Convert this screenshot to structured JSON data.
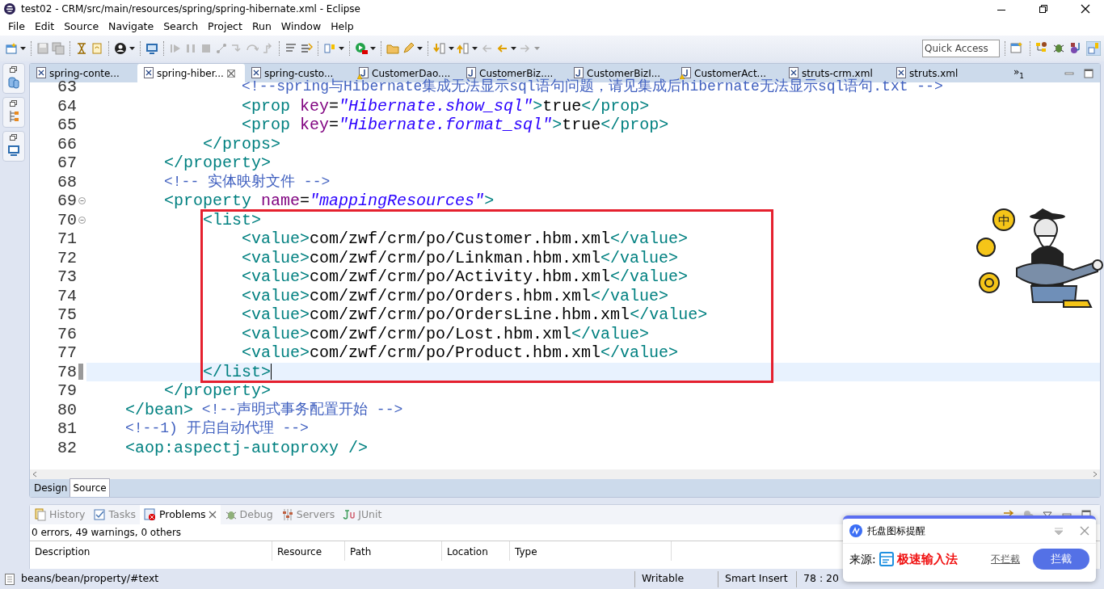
{
  "window": {
    "title": "test02 - CRM/src/main/resources/spring/spring-hibernate.xml - Eclipse"
  },
  "menu": [
    "File",
    "Edit",
    "Source",
    "Navigate",
    "Search",
    "Project",
    "Run",
    "Window",
    "Help"
  ],
  "quick_access": {
    "placeholder": "Quick Access"
  },
  "editor_tabs": [
    {
      "label": "spring-conte...",
      "kind": "xml",
      "selected": false,
      "warning": false
    },
    {
      "label": "spring-hiber...",
      "kind": "xml",
      "selected": true,
      "warning": false
    },
    {
      "label": "spring-custo...",
      "kind": "xml",
      "selected": false,
      "warning": false
    },
    {
      "label": "CustomerDao....",
      "kind": "java",
      "selected": false,
      "warning": true
    },
    {
      "label": "CustomerBiz....",
      "kind": "java",
      "selected": false,
      "warning": false
    },
    {
      "label": "CustomerBizI...",
      "kind": "java",
      "selected": false,
      "warning": false
    },
    {
      "label": "CustomerAct...",
      "kind": "java",
      "selected": false,
      "warning": true
    },
    {
      "label": "struts-crm.xml",
      "kind": "xml",
      "selected": false,
      "warning": false
    },
    {
      "label": "struts.xml",
      "kind": "xml",
      "selected": false,
      "warning": false
    }
  ],
  "tab_overflow": {
    "symbol": "»",
    "count": "1"
  },
  "editor": {
    "sections": [
      {
        "highlighted": false,
        "lines": [
          {
            "number": "63",
            "fold": false,
            "current": false,
            "segments": [
              {
                "kind": "comment",
                "text": "                <!--spring与Hibernate集成无法显示sql语句问题，请见集成后hibernate无法显示sql语句.txt -->"
              }
            ]
          },
          {
            "number": "64",
            "fold": false,
            "current": false,
            "segments": [
              {
                "kind": "tag",
                "text": "                <prop "
              },
              {
                "kind": "attr",
                "text": "key"
              },
              {
                "kind": "text",
                "text": "="
              },
              {
                "kind": "value",
                "text": "\"Hibernate.show_sql\""
              },
              {
                "kind": "tag",
                "text": ">"
              },
              {
                "kind": "text",
                "text": "true"
              },
              {
                "kind": "tag",
                "text": "</prop>"
              }
            ]
          },
          {
            "number": "65",
            "fold": false,
            "current": false,
            "segments": [
              {
                "kind": "tag",
                "text": "                <prop "
              },
              {
                "kind": "attr",
                "text": "key"
              },
              {
                "kind": "text",
                "text": "="
              },
              {
                "kind": "value",
                "text": "\"Hibernate.format_sql\""
              },
              {
                "kind": "tag",
                "text": ">"
              },
              {
                "kind": "text",
                "text": "true"
              },
              {
                "kind": "tag",
                "text": "</prop>"
              }
            ]
          },
          {
            "number": "66",
            "fold": false,
            "current": false,
            "segments": [
              {
                "kind": "tag",
                "text": "            </props>"
              }
            ]
          },
          {
            "number": "67",
            "fold": false,
            "current": false,
            "segments": [
              {
                "kind": "tag",
                "text": "        </property>"
              }
            ]
          },
          {
            "number": "68",
            "fold": false,
            "current": false,
            "segments": [
              {
                "kind": "comment",
                "text": "        <!-- 实体映射文件 -->"
              }
            ]
          },
          {
            "number": "69",
            "fold": true,
            "current": false,
            "segments": [
              {
                "kind": "tag",
                "text": "        <property "
              },
              {
                "kind": "attr",
                "text": "name"
              },
              {
                "kind": "text",
                "text": "="
              },
              {
                "kind": "value",
                "text": "\"mappingResources\""
              },
              {
                "kind": "tag",
                "text": ">"
              }
            ]
          }
        ]
      },
      {
        "highlighted": true,
        "lines": [
          {
            "number": "70",
            "fold": true,
            "current": false,
            "segments": [
              {
                "kind": "tag",
                "text": "            <list>"
              }
            ]
          },
          {
            "number": "71",
            "fold": false,
            "current": false,
            "segments": [
              {
                "kind": "tag",
                "text": "                <value>"
              },
              {
                "kind": "text",
                "text": "com/zwf/crm/po/Customer.hbm.xml"
              },
              {
                "kind": "tag",
                "text": "</value>"
              }
            ]
          },
          {
            "number": "72",
            "fold": false,
            "current": false,
            "segments": [
              {
                "kind": "tag",
                "text": "                <value>"
              },
              {
                "kind": "text",
                "text": "com/zwf/crm/po/Linkman.hbm.xml"
              },
              {
                "kind": "tag",
                "text": "</value>"
              }
            ]
          },
          {
            "number": "73",
            "fold": false,
            "current": false,
            "segments": [
              {
                "kind": "tag",
                "text": "                <value>"
              },
              {
                "kind": "text",
                "text": "com/zwf/crm/po/Activity.hbm.xml"
              },
              {
                "kind": "tag",
                "text": "</value>"
              }
            ]
          },
          {
            "number": "74",
            "fold": false,
            "current": false,
            "segments": [
              {
                "kind": "tag",
                "text": "                <value>"
              },
              {
                "kind": "text",
                "text": "com/zwf/crm/po/Orders.hbm.xml"
              },
              {
                "kind": "tag",
                "text": "</value>"
              }
            ]
          },
          {
            "number": "75",
            "fold": false,
            "current": false,
            "segments": [
              {
                "kind": "tag",
                "text": "                <value>"
              },
              {
                "kind": "text",
                "text": "com/zwf/crm/po/OrdersLine.hbm.xml"
              },
              {
                "kind": "tag",
                "text": "</value>"
              }
            ]
          },
          {
            "number": "76",
            "fold": false,
            "current": false,
            "segments": [
              {
                "kind": "tag",
                "text": "                <value>"
              },
              {
                "kind": "text",
                "text": "com/zwf/crm/po/Lost.hbm.xml"
              },
              {
                "kind": "tag",
                "text": "</value>"
              }
            ]
          },
          {
            "number": "77",
            "fold": false,
            "current": false,
            "segments": [
              {
                "kind": "tag",
                "text": "                <value>"
              },
              {
                "kind": "text",
                "text": "com/zwf/crm/po/Product.hbm.xml"
              },
              {
                "kind": "tag",
                "text": "</value>"
              }
            ]
          },
          {
            "number": "78",
            "fold": false,
            "current": true,
            "segments": [
              {
                "kind": "tag",
                "text": "            </list>"
              }
            ]
          }
        ]
      },
      {
        "highlighted": false,
        "lines": [
          {
            "number": "79",
            "fold": false,
            "current": false,
            "segments": [
              {
                "kind": "tag",
                "text": "        </property>"
              }
            ]
          },
          {
            "number": "80",
            "fold": false,
            "current": false,
            "segments": [
              {
                "kind": "tag",
                "text": "    </bean>"
              },
              {
                "kind": "comment",
                "text": " <!--声明式事务配置开始 -->"
              }
            ]
          },
          {
            "number": "81",
            "fold": false,
            "current": false,
            "segments": [
              {
                "kind": "comment",
                "text": "    <!--1) 开启自动代理 -->"
              }
            ]
          },
          {
            "number": "82",
            "fold": false,
            "current": false,
            "segments": [
              {
                "kind": "tag",
                "text": "    <aop:aspectj-autoproxy />"
              }
            ]
          }
        ]
      }
    ]
  },
  "editor_mode_tabs": [
    {
      "label": "Design",
      "selected": false
    },
    {
      "label": "Source",
      "selected": true
    }
  ],
  "bottom_tabs": [
    {
      "label": "History",
      "kind": "history",
      "selected": false
    },
    {
      "label": "Tasks",
      "kind": "tasks",
      "selected": false
    },
    {
      "label": "Problems",
      "kind": "problems",
      "selected": true
    },
    {
      "label": "Debug",
      "kind": "debug",
      "selected": false
    },
    {
      "label": "Servers",
      "kind": "servers",
      "selected": false
    },
    {
      "label": "JUnit",
      "kind": "junit",
      "selected": false
    }
  ],
  "problems": {
    "summary": "0 errors, 49 warnings, 0 others",
    "columns": [
      "Description",
      "Resource",
      "Path",
      "Location",
      "Type"
    ]
  },
  "status_bar": {
    "path": "beans/bean/property/#text",
    "mode": "Writable",
    "insert": "Smart Insert",
    "position": "78 : 20"
  },
  "mascot": {
    "coin_label": "中"
  },
  "popup": {
    "title": "托盘图标提醒",
    "source_label": "来源:",
    "source_name": "极速输入法",
    "secondary": "不拦截",
    "primary": "拦截"
  }
}
